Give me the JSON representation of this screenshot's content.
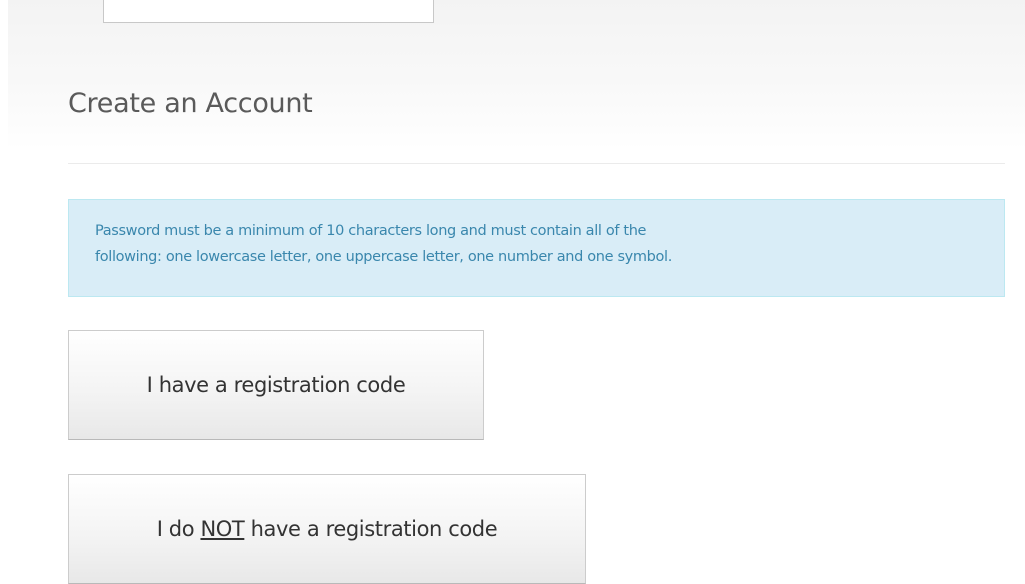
{
  "page": {
    "title": "Create an Account"
  },
  "alert": {
    "line1": "Password must be a minimum of 10 characters long and must contain all of the",
    "line2": "following: one lowercase letter, one uppercase letter, one number and one symbol."
  },
  "buttons": {
    "have_code_label": "I have a registration code",
    "no_code_prefix": "I do",
    "no_code_emphasis": "NOT",
    "no_code_suffix": "have a registration code"
  },
  "colors": {
    "alert_background": "#d9edf7",
    "alert_border": "#bce8f1",
    "alert_text": "#3a87ad",
    "title_text": "#5a5a5a"
  }
}
